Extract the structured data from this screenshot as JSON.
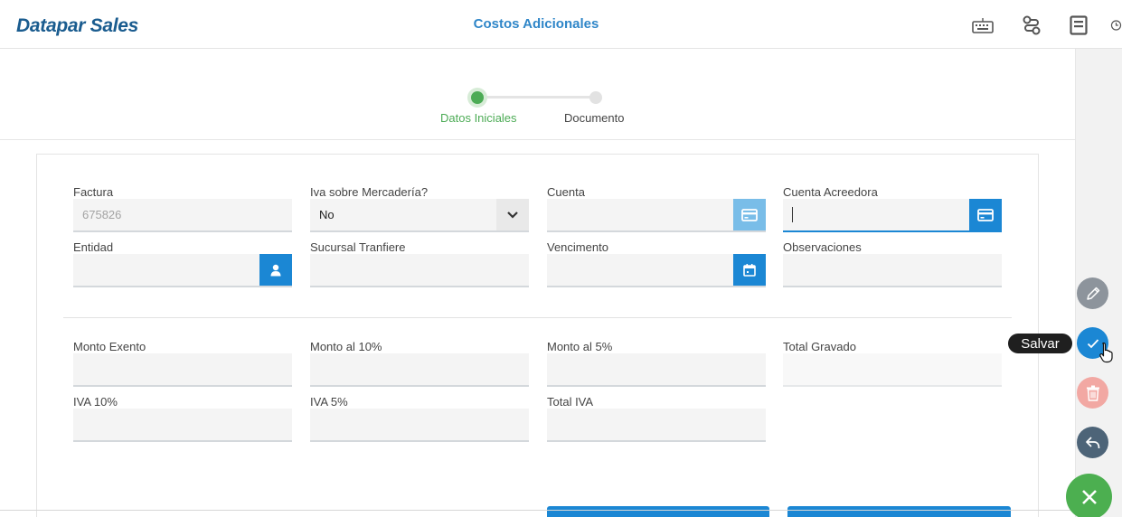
{
  "app": {
    "brand": "Datapar Sales",
    "title": "Costos Adicionales"
  },
  "header_icons": [
    "keyboard-icon",
    "route-icon",
    "document-icon",
    "clock-icon"
  ],
  "stepper": {
    "steps": [
      {
        "label": "Datos Iniciales",
        "active": true
      },
      {
        "label": "Documento",
        "active": false
      }
    ]
  },
  "form": {
    "factura": {
      "label": "Factura",
      "value": "675826"
    },
    "iva_mercaderia": {
      "label": "Iva sobre Mercadería?",
      "value": "No"
    },
    "cuenta": {
      "label": "Cuenta",
      "value": ""
    },
    "cuenta_acreedora": {
      "label": "Cuenta Acreedora",
      "value": ""
    },
    "entidad": {
      "label": "Entidad",
      "value": ""
    },
    "sucursal": {
      "label": "Sucursal Tranfiere",
      "value": ""
    },
    "vencimento": {
      "label": "Vencimento",
      "value": ""
    },
    "observaciones": {
      "label": "Observaciones",
      "value": ""
    },
    "monto_exento": {
      "label": "Monto Exento",
      "value": ""
    },
    "monto_10": {
      "label": "Monto al 10%",
      "value": ""
    },
    "monto_5": {
      "label": "Monto al 5%",
      "value": ""
    },
    "total_gravado": {
      "label": "Total Gravado",
      "value": ""
    },
    "iva_10": {
      "label": "IVA 10%",
      "value": ""
    },
    "iva_5": {
      "label": "IVA 5%",
      "value": ""
    },
    "total_iva": {
      "label": "Total IVA",
      "value": ""
    }
  },
  "actions": {
    "save_tooltip": "Salvar"
  },
  "colors": {
    "primary": "#1b87d4",
    "brand": "#1a5c8f",
    "success": "#4cab55",
    "danger": "#f0a39e",
    "close": "#4caf50"
  }
}
